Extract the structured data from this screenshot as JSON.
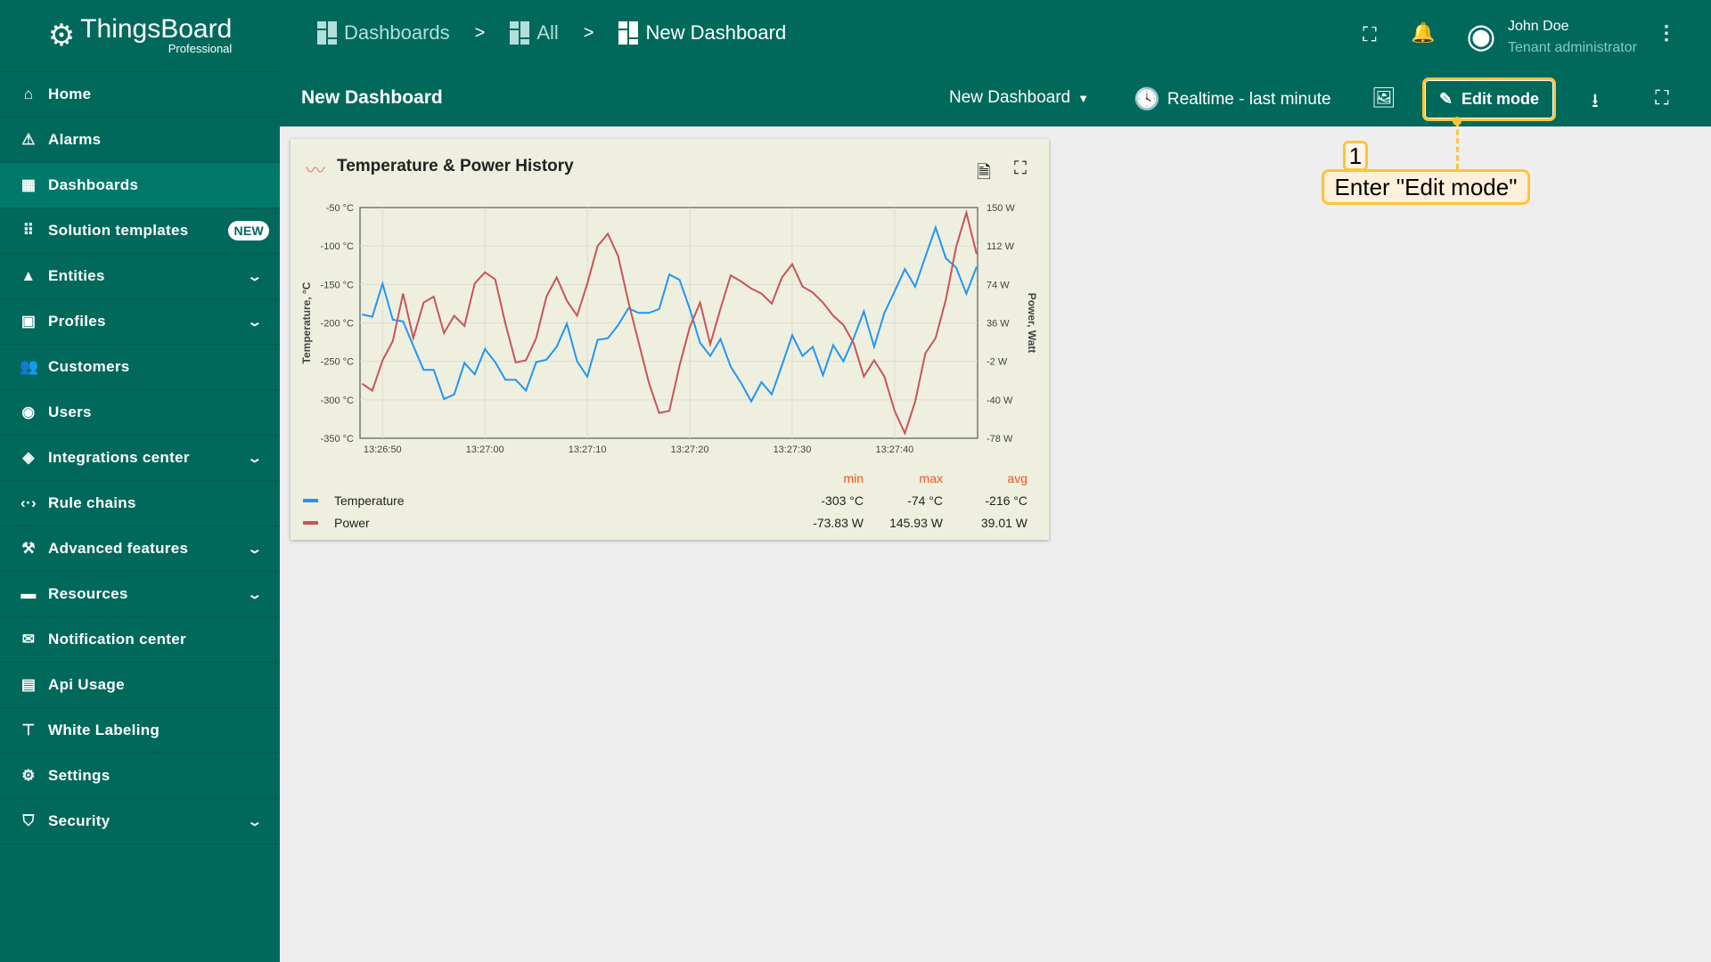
{
  "app": {
    "brand": "ThingsBoard",
    "edition": "Professional"
  },
  "sidebar": {
    "items": [
      {
        "label": "Home",
        "icon": "home-icon",
        "glyph": "⌂"
      },
      {
        "label": "Alarms",
        "icon": "warning-icon",
        "glyph": "⚠"
      },
      {
        "label": "Dashboards",
        "icon": "dashboard-icon",
        "glyph": "▦",
        "active": true
      },
      {
        "label": "Solution templates",
        "icon": "apps-icon",
        "glyph": "⠿",
        "badge": "NEW"
      },
      {
        "label": "Entities",
        "icon": "category-icon",
        "glyph": "▲",
        "expandable": true
      },
      {
        "label": "Profiles",
        "icon": "badge-icon",
        "glyph": "▣",
        "expandable": true
      },
      {
        "label": "Customers",
        "icon": "people-icon",
        "glyph": "👥"
      },
      {
        "label": "Users",
        "icon": "account-circle-icon",
        "glyph": "◉"
      },
      {
        "label": "Integrations center",
        "icon": "integration-icon",
        "glyph": "◈",
        "expandable": true
      },
      {
        "label": "Rule chains",
        "icon": "settings-ethernet-icon",
        "glyph": "‹·›"
      },
      {
        "label": "Advanced features",
        "icon": "construction-icon",
        "glyph": "⚒",
        "expandable": true
      },
      {
        "label": "Resources",
        "icon": "folder-icon",
        "glyph": "▬",
        "expandable": true
      },
      {
        "label": "Notification center",
        "icon": "notification-icon",
        "glyph": "✉"
      },
      {
        "label": "Api Usage",
        "icon": "insert-chart-icon",
        "glyph": "▤"
      },
      {
        "label": "White Labeling",
        "icon": "format-paint-icon",
        "glyph": "⊤"
      },
      {
        "label": "Settings",
        "icon": "gear-icon",
        "glyph": "⚙"
      },
      {
        "label": "Security",
        "icon": "shield-icon",
        "glyph": "⛉",
        "expandable": true
      }
    ]
  },
  "breadcrumb": [
    "Dashboards",
    "All",
    "New Dashboard"
  ],
  "breadcrumb_sep": ">",
  "header": {
    "title": "New Dashboard",
    "dashboard_select": "New Dashboard",
    "timewindow": "Realtime - last minute",
    "edit_mode": "Edit mode"
  },
  "user": {
    "name": "John Doe",
    "role": "Tenant administrator"
  },
  "annotation": {
    "step": "1",
    "text": "Enter \"Edit mode\"",
    "color": "#fcc438"
  },
  "widget": {
    "title": "Temperature & Power History",
    "legend": {
      "headers": [
        "min",
        "max",
        "avg"
      ],
      "rows": [
        {
          "name": "Temperature",
          "color": "#2196f3",
          "min": "-303 °C",
          "max": "-74 °C",
          "avg": "-216 °C"
        },
        {
          "name": "Power",
          "color": "#c8545a",
          "min": "-73.83 W",
          "max": "145.93 W",
          "avg": "39.01 W"
        }
      ]
    }
  },
  "chart_data": {
    "type": "line",
    "xlabel": "",
    "x_start": "13:26:48",
    "x_step_seconds": 1,
    "x_ticks": [
      "13:26:50",
      "13:27:00",
      "13:27:10",
      "13:27:20",
      "13:27:30",
      "13:27:40"
    ],
    "xlim": [
      "13:26:48",
      "13:27:48"
    ],
    "y_left": {
      "label": "Temperature, °C",
      "ylim": [
        -350,
        -50
      ],
      "ticks": [
        "-50 °C",
        "-100 °C",
        "-150 °C",
        "-200 °C",
        "-250 °C",
        "-300 °C",
        "-350 °C"
      ]
    },
    "y_right": {
      "label": "Power, Watt",
      "ylim": [
        -78,
        150
      ],
      "ticks": [
        "150 W",
        "112 W",
        "74 W",
        "36 W",
        "-2 W",
        "-40 W",
        "-78 W"
      ]
    },
    "grid": true,
    "series": [
      {
        "name": "Temperature",
        "axis": "left",
        "color": "#2196f3",
        "values": [
          -189,
          -192,
          -149,
          -196,
          -198,
          -230,
          -261,
          -261,
          -299,
          -293,
          -252,
          -267,
          -234,
          -251,
          -274,
          -274,
          -288,
          -251,
          -248,
          -231,
          -201,
          -250,
          -270,
          -222,
          -220,
          -203,
          -181,
          -187,
          -187,
          -182,
          -137,
          -144,
          -182,
          -226,
          -243,
          -221,
          -257,
          -278,
          -302,
          -277,
          -293,
          -255,
          -216,
          -243,
          -231,
          -268,
          -229,
          -250,
          -220,
          -185,
          -231,
          -187,
          -159,
          -130,
          -153,
          -114,
          -76,
          -116,
          -128,
          -162,
          -127
        ]
      },
      {
        "name": "Power",
        "axis": "right",
        "color": "#c8545a",
        "values": [
          -24,
          -31,
          -1,
          18,
          65,
          21,
          56,
          62,
          26,
          43,
          33,
          75,
          86,
          79,
          35,
          -3,
          -1,
          21,
          62,
          81,
          58,
          43,
          75,
          112,
          124,
          102,
          57,
          17,
          -23,
          -53,
          -51,
          -6,
          32,
          56,
          15,
          50,
          83,
          77,
          70,
          65,
          55,
          81,
          94,
          72,
          66,
          56,
          43,
          34,
          16,
          -17,
          -1,
          -17,
          -51,
          -73,
          -42,
          6,
          21,
          59,
          111,
          145,
          104
        ]
      }
    ]
  }
}
